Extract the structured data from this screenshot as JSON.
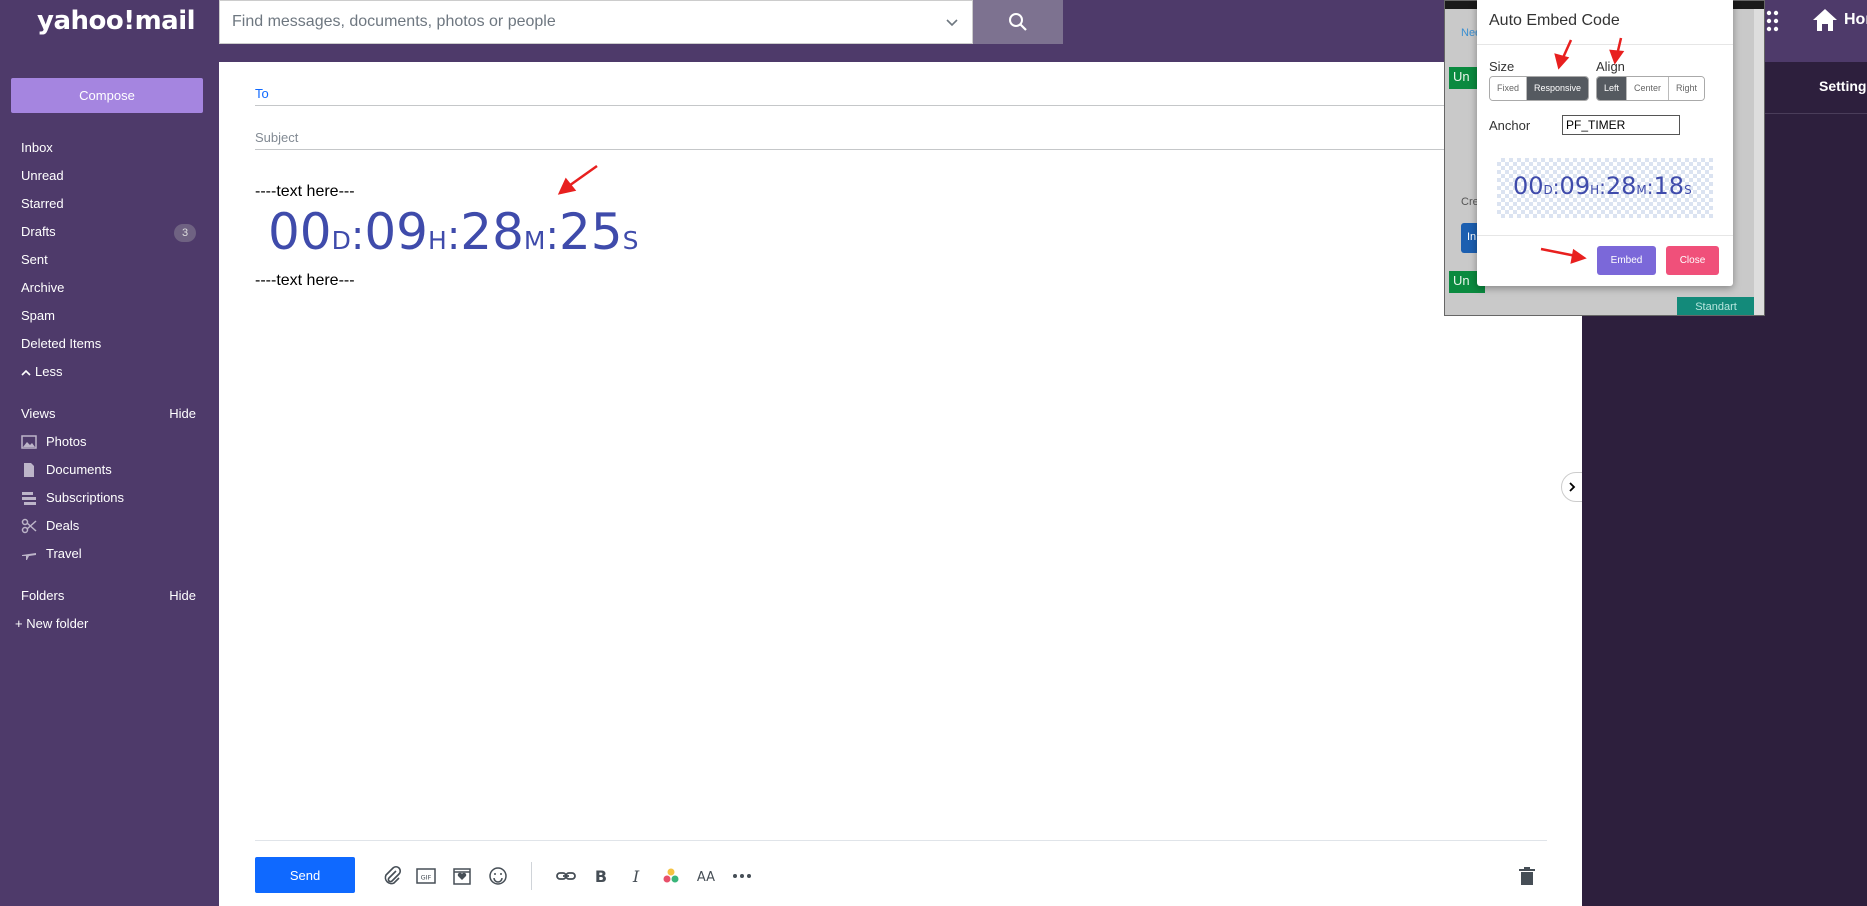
{
  "header": {
    "logo": "yahoo!mail",
    "search_placeholder": "Find messages, documents, photos or people",
    "home_label": "Hon"
  },
  "sidebar": {
    "compose_label": "Compose",
    "items": [
      {
        "label": "Inbox",
        "badge": ""
      },
      {
        "label": "Unread",
        "badge": ""
      },
      {
        "label": "Starred",
        "badge": ""
      },
      {
        "label": "Drafts",
        "badge": "3"
      },
      {
        "label": "Sent",
        "badge": ""
      },
      {
        "label": "Archive",
        "badge": ""
      },
      {
        "label": "Spam",
        "badge": ""
      },
      {
        "label": "Deleted Items",
        "badge": ""
      }
    ],
    "less_label": "Less",
    "views_label": "Views",
    "views_hide": "Hide",
    "views": [
      {
        "label": "Photos",
        "icon": "photo-icon"
      },
      {
        "label": "Documents",
        "icon": "document-icon"
      },
      {
        "label": "Subscriptions",
        "icon": "subscriptions-icon"
      },
      {
        "label": "Deals",
        "icon": "scissors-icon"
      },
      {
        "label": "Travel",
        "icon": "plane-icon"
      }
    ],
    "folders_label": "Folders",
    "folders_hide": "Hide",
    "new_folder_label": "New folder"
  },
  "compose": {
    "to_label": "To",
    "subject_label": "Subject",
    "body_line_1": "----text here---",
    "body_line_2": "----text here---",
    "timer": {
      "days": "00",
      "d": "D",
      "hours": "09",
      "h": "H",
      "minutes": "28",
      "m": "M",
      "seconds": "25",
      "s": "S"
    },
    "send_label": "Send"
  },
  "right_panel": {
    "settings_label": "Settings"
  },
  "background_window": {
    "text_need": "Need",
    "text_un": "Un",
    "text_cre": "Cre",
    "text_in": "In",
    "text_standard": "Standart"
  },
  "embed_modal": {
    "title": "Auto Embed Code",
    "size_label": "Size",
    "size_options": [
      "Fixed",
      "Responsive"
    ],
    "size_selected": "Responsive",
    "align_label": "Align",
    "align_options": [
      "Left",
      "Center",
      "Right"
    ],
    "align_selected": "Left",
    "anchor_label": "Anchor",
    "anchor_value": "PF_TIMER",
    "preview_timer": {
      "days": "00",
      "d": "D",
      "hours": "09",
      "h": "H",
      "minutes": "28",
      "m": "M",
      "seconds": "18",
      "s": "S"
    },
    "embed_label": "Embed",
    "close_label": "Close"
  },
  "colors": {
    "sidebar_bg": "#4e3a6a",
    "compose_btn": "#a585e0",
    "send_btn": "#0f69ff",
    "timer_text": "#3f4bab",
    "embed_btn": "#7b68d9",
    "close_btn": "#f0507a",
    "annotation_arrow": "#e8201f"
  }
}
